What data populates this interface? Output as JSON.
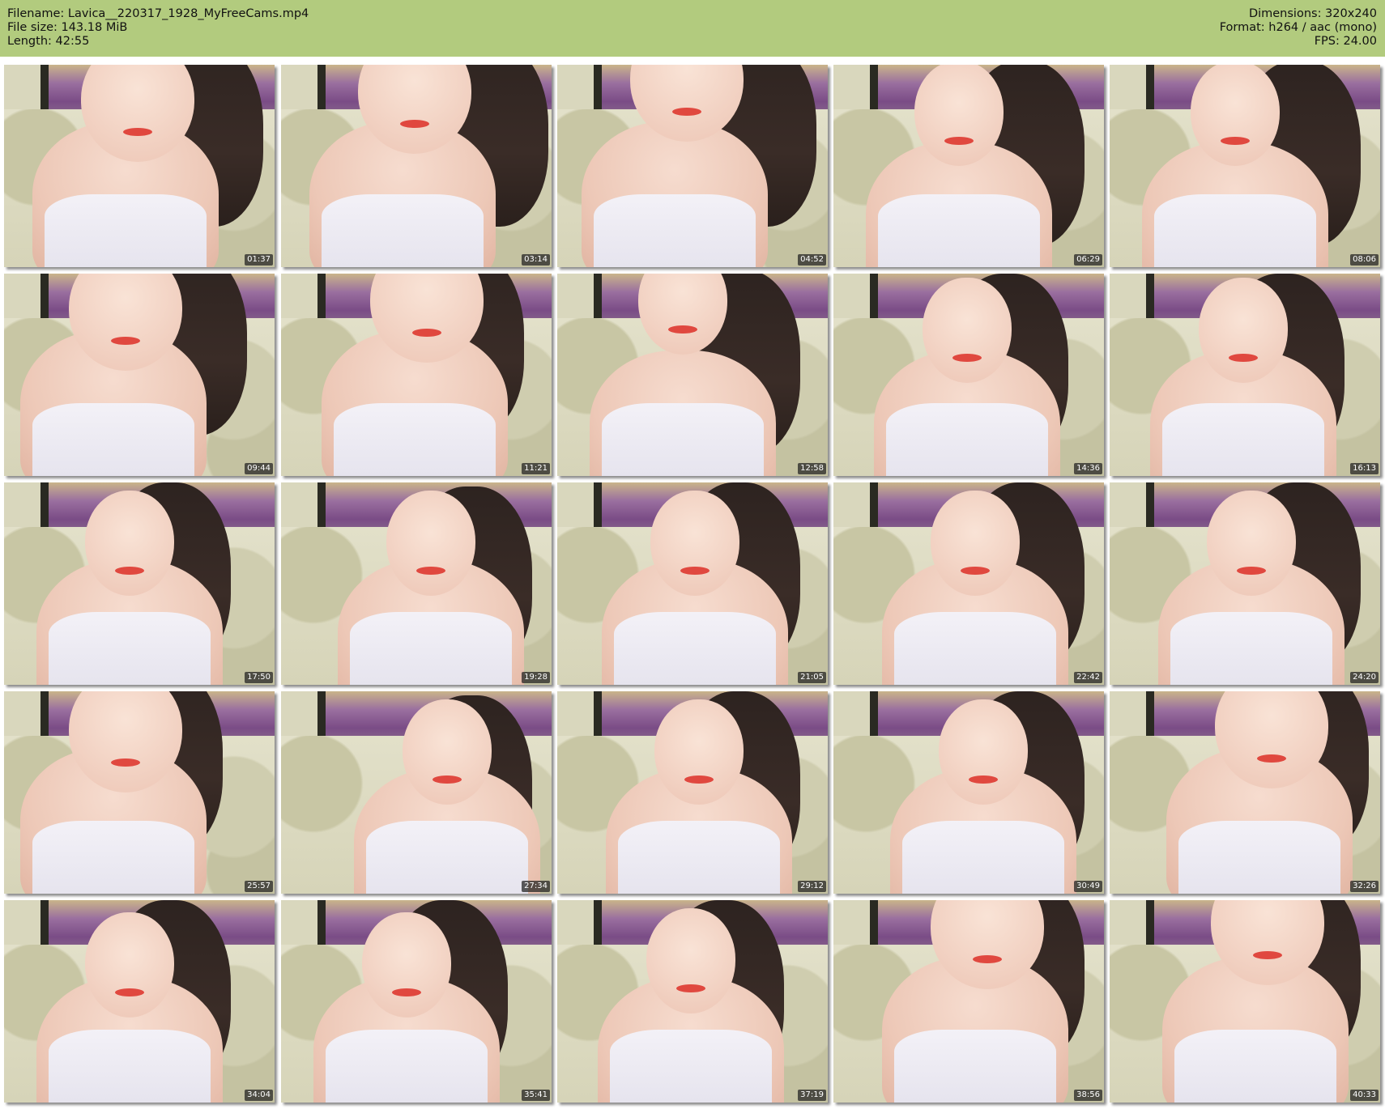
{
  "header": {
    "filename_line": "Filename: Lavica__220317_1928_MyFreeCams.mp4",
    "filesize_line": "File size: 143.18 MiB",
    "length_line": "Length: 42:55",
    "dimensions_line": "Dimensions: 320x240",
    "format_line": "Format: h264 / aac (mono)",
    "fps_line": "FPS: 24.00",
    "bg_color": "#b2cb7e"
  },
  "thumbnails": [
    {
      "timestamp": "01:37"
    },
    {
      "timestamp": "03:14"
    },
    {
      "timestamp": "04:52"
    },
    {
      "timestamp": "06:29"
    },
    {
      "timestamp": "08:06"
    },
    {
      "timestamp": "09:44"
    },
    {
      "timestamp": "11:21"
    },
    {
      "timestamp": "12:58"
    },
    {
      "timestamp": "14:36"
    },
    {
      "timestamp": "16:13"
    },
    {
      "timestamp": "17:50"
    },
    {
      "timestamp": "19:28"
    },
    {
      "timestamp": "21:05"
    },
    {
      "timestamp": "22:42"
    },
    {
      "timestamp": "24:20"
    },
    {
      "timestamp": "25:57"
    },
    {
      "timestamp": "27:34"
    },
    {
      "timestamp": "29:12"
    },
    {
      "timestamp": "30:49"
    },
    {
      "timestamp": "32:26"
    },
    {
      "timestamp": "34:04"
    },
    {
      "timestamp": "35:41"
    },
    {
      "timestamp": "37:19"
    },
    {
      "timestamp": "38:56"
    },
    {
      "timestamp": "40:33"
    }
  ]
}
